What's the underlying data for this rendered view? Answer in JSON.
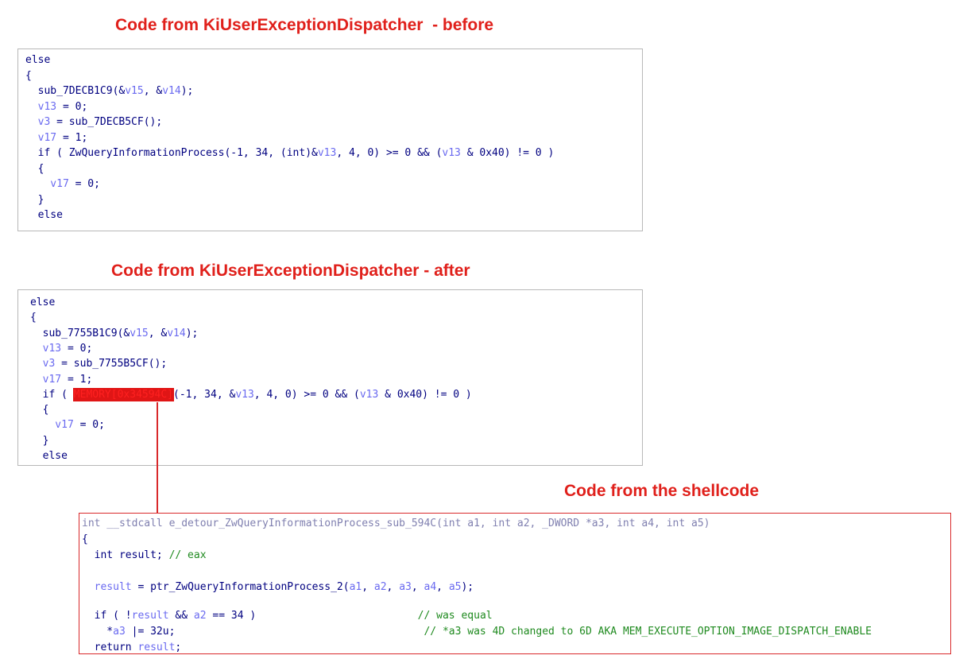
{
  "headings": {
    "before": "Code from KiUserExceptionDispatcher  - before",
    "after": "Code from KiUserExceptionDispatcher - after",
    "shellcode": "Code from the shellcode"
  },
  "before_code": [
    [
      [
        "k",
        "else"
      ]
    ],
    [
      [
        "k",
        "{"
      ]
    ],
    [
      [
        "k",
        "  sub_7DECB1C9(&"
      ],
      [
        "v",
        "v15"
      ],
      [
        "k",
        ", &"
      ],
      [
        "v",
        "v14"
      ],
      [
        "k",
        ");"
      ]
    ],
    [
      [
        "v",
        "  v13"
      ],
      [
        "k",
        " = 0;"
      ]
    ],
    [
      [
        "v",
        "  v3"
      ],
      [
        "k",
        " = sub_7DECB5CF();"
      ]
    ],
    [
      [
        "v",
        "  v17"
      ],
      [
        "k",
        " = 1;"
      ]
    ],
    [
      [
        "k",
        "  if ( ZwQueryInformationProcess(-1, 34, (int)&"
      ],
      [
        "v",
        "v13"
      ],
      [
        "k",
        ", 4, 0) >= 0 && ("
      ],
      [
        "v",
        "v13"
      ],
      [
        "k",
        " & 0x40) != 0 )"
      ]
    ],
    [
      [
        "k",
        "  {"
      ]
    ],
    [
      [
        "v",
        "    v17"
      ],
      [
        "k",
        " = 0;"
      ]
    ],
    [
      [
        "k",
        "  }"
      ]
    ],
    [
      [
        "k",
        "  else"
      ]
    ]
  ],
  "after_code": [
    [
      [
        "k",
        "else"
      ]
    ],
    [
      [
        "k",
        "{"
      ]
    ],
    [
      [
        "k",
        "  sub_7755B1C9(&"
      ],
      [
        "v",
        "v15"
      ],
      [
        "k",
        ", &"
      ],
      [
        "v",
        "v14"
      ],
      [
        "k",
        ");"
      ]
    ],
    [
      [
        "v",
        "  v13"
      ],
      [
        "k",
        " = 0;"
      ]
    ],
    [
      [
        "v",
        "  v3"
      ],
      [
        "k",
        " = sub_7755B5CF();"
      ]
    ],
    [
      [
        "v",
        "  v17"
      ],
      [
        "k",
        " = 1;"
      ]
    ],
    [
      [
        "k",
        "  if ( "
      ],
      [
        "h",
        "MEMORY[0x34594C]"
      ],
      [
        "k",
        "(-1, 34, &"
      ],
      [
        "v",
        "v13"
      ],
      [
        "k",
        ", 4, 0) >= 0 && ("
      ],
      [
        "v",
        "v13"
      ],
      [
        "k",
        " & 0x40) != 0 )"
      ]
    ],
    [
      [
        "k",
        "  {"
      ]
    ],
    [
      [
        "v",
        "    v17"
      ],
      [
        "k",
        " = 0;"
      ]
    ],
    [
      [
        "k",
        "  }"
      ]
    ],
    [
      [
        "k",
        "  else"
      ]
    ]
  ],
  "shell_code": [
    [
      [
        "g",
        "int __stdcall e_detour_ZwQueryInformationProcess_sub_594C(int a1, int a2, _DWORD *a3, int a4, int a5)"
      ]
    ],
    [
      [
        "k",
        "{"
      ]
    ],
    [
      [
        "k",
        "  int result; "
      ],
      [
        "c",
        "// eax"
      ]
    ],
    [
      [
        "k",
        ""
      ]
    ],
    [
      [
        "v",
        "  result"
      ],
      [
        "k",
        " = ptr_ZwQueryInformationProcess_2("
      ],
      [
        "v",
        "a1"
      ],
      [
        "k",
        ", "
      ],
      [
        "v",
        "a2"
      ],
      [
        "k",
        ", "
      ],
      [
        "v",
        "a3"
      ],
      [
        "k",
        ", "
      ],
      [
        "v",
        "a4"
      ],
      [
        "k",
        ", "
      ],
      [
        "v",
        "a5"
      ],
      [
        "k",
        ");"
      ]
    ],
    [
      [
        "k",
        ""
      ]
    ],
    [
      [
        "k",
        "  if ( !"
      ],
      [
        "v",
        "result"
      ],
      [
        "k",
        " && "
      ],
      [
        "v",
        "a2"
      ],
      [
        "k",
        " == 34 )                          "
      ],
      [
        "c",
        "// was equal"
      ]
    ],
    [
      [
        "k",
        "    *"
      ],
      [
        "v",
        "a3"
      ],
      [
        "k",
        " |= 32u;                                        "
      ],
      [
        "c",
        "// *a3 was 4D changed to 6D AKA MEM_EXECUTE_OPTION_IMAGE_DISPATCH_ENABLE"
      ]
    ],
    [
      [
        "k",
        "  return "
      ],
      [
        "v",
        "result"
      ],
      [
        "k",
        ";"
      ]
    ]
  ],
  "colors": {
    "heading": "#e0201b",
    "keyword": "#000080",
    "variable": "#6a6af0",
    "comment": "#1f8a1f",
    "highlight": "#e01515",
    "connector": "#d9292b"
  }
}
